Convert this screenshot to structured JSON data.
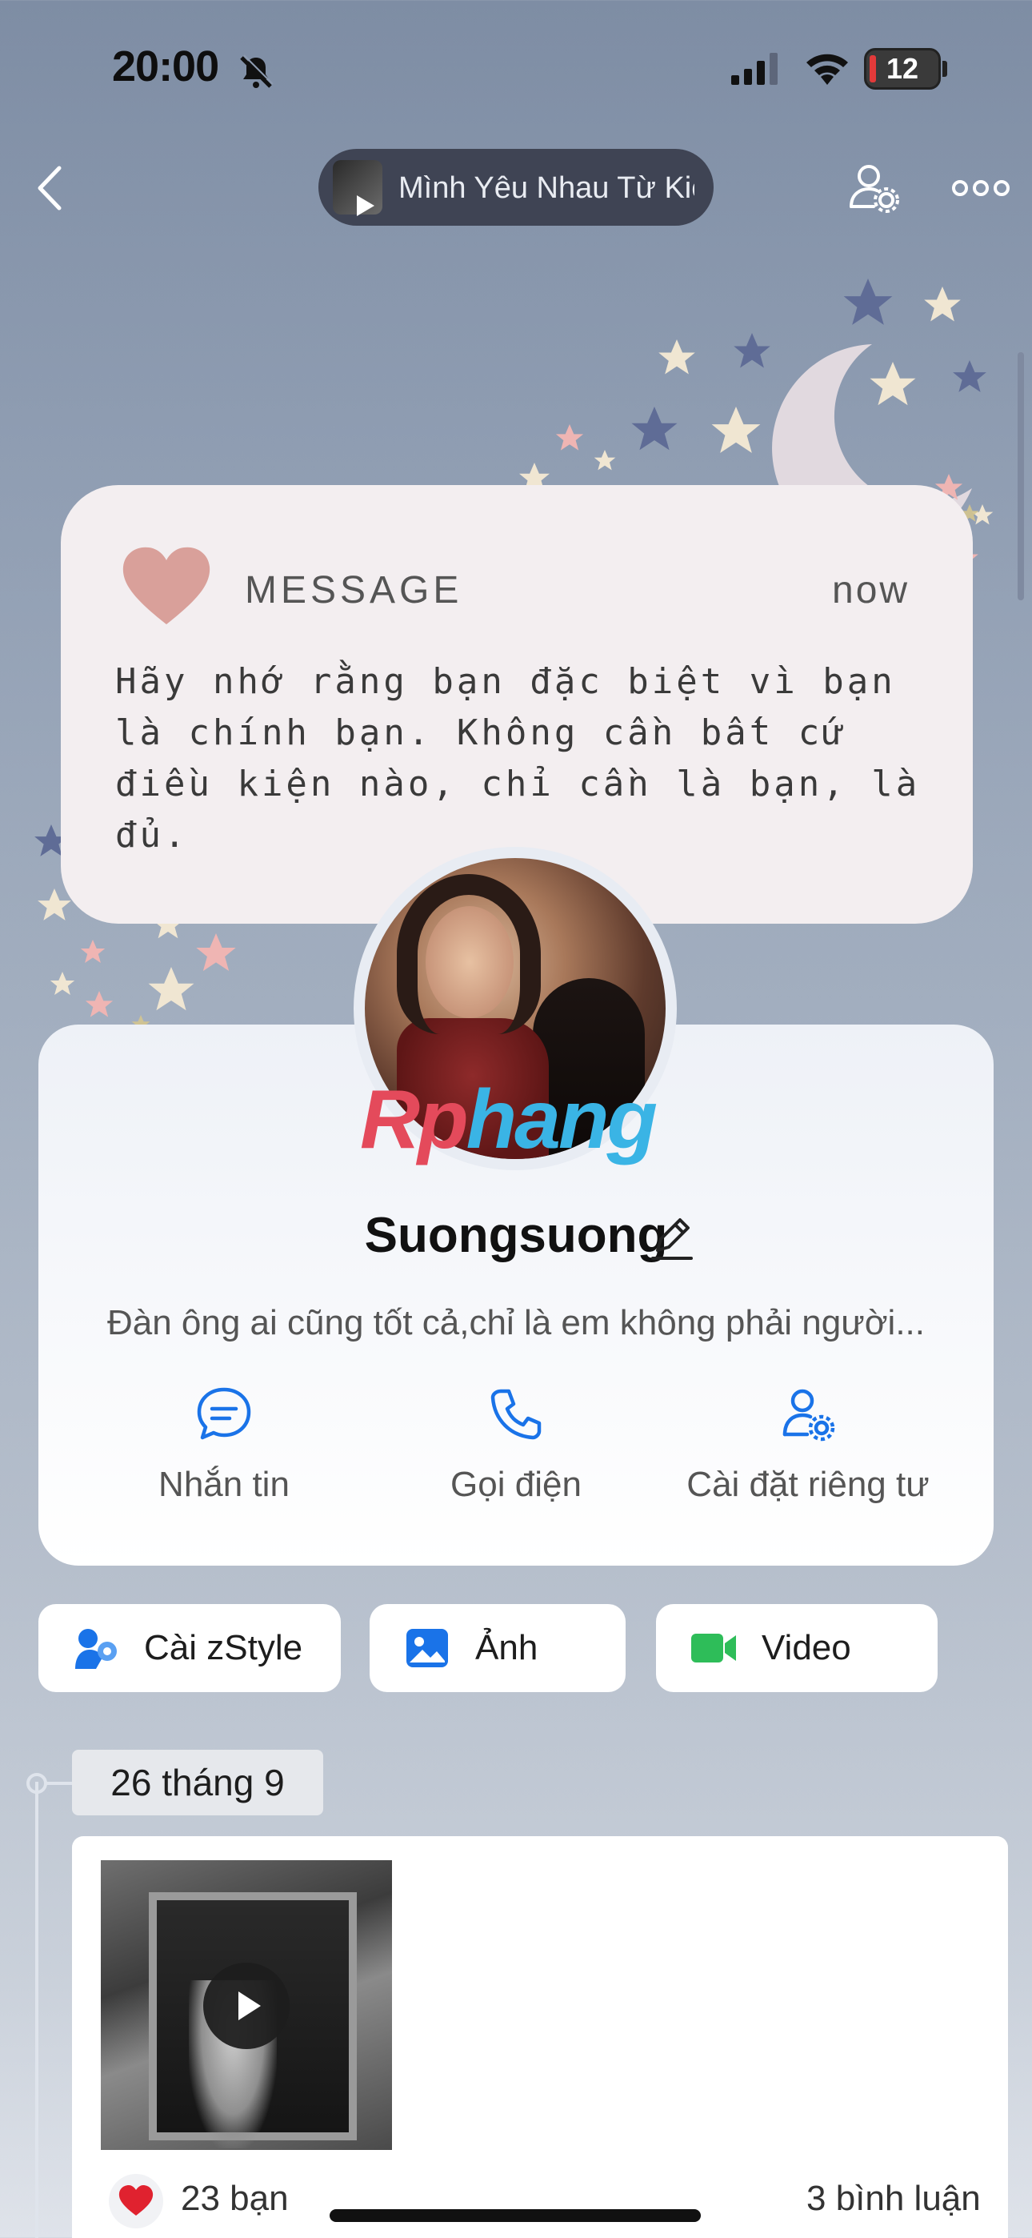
{
  "status_bar": {
    "time": "20:00",
    "battery": "12"
  },
  "nav": {
    "music_title": "Mình Yêu Nhau Từ Kiếp Nào"
  },
  "message_card": {
    "label": "MESSAGE",
    "time": "now",
    "text": "Hãy nhớ rằng bạn đặc biệt vì bạn là chính bạn. Không cần bất cứ điều kiện nào, chỉ cần là bạn, là đủ."
  },
  "profile": {
    "watermark": "Rphang",
    "name": "Suongsuong",
    "bio": "Đàn ông ai cũng tốt cả,chỉ là em không phải người...",
    "actions": [
      {
        "label": "Nhắn tin",
        "icon": "chat-icon"
      },
      {
        "label": "Gọi điện",
        "icon": "phone-icon"
      },
      {
        "label": "Cài đặt riêng tư",
        "icon": "user-settings-icon"
      }
    ]
  },
  "chips": [
    {
      "label": "Cài zStyle",
      "icon": "zstyle-icon"
    },
    {
      "label": "Ảnh",
      "icon": "photo-icon"
    },
    {
      "label": "Video",
      "icon": "video-icon"
    }
  ],
  "timeline": {
    "date": "26 tháng 9",
    "post": {
      "likes": "23 bạn",
      "comments": "3 bình luận"
    }
  },
  "colors": {
    "accent_blue": "#1a73e8",
    "video_green": "#2ebd59",
    "heart_pink": "#d9a09a"
  }
}
